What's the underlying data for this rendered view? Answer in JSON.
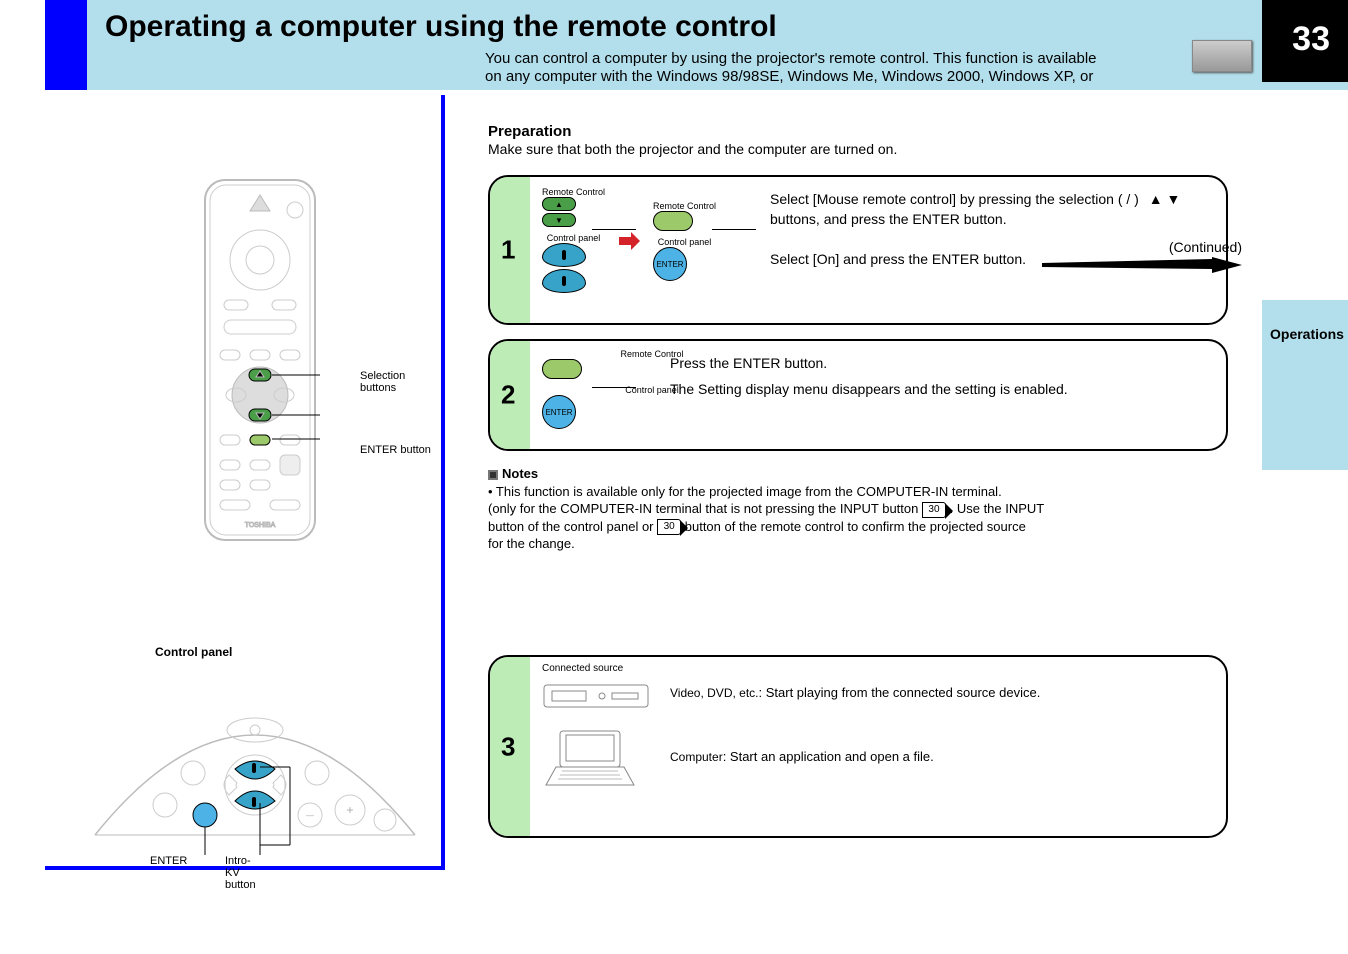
{
  "page_number": "33",
  "header": {
    "title": "Operating a computer using the remote control",
    "subtitle1": "You can control a computer by using the projector's remote control. This function is available",
    "subtitle2": "on any computer with the Windows 98/98SE, Windows Me, Windows 2000, Windows XP, or"
  },
  "side_tab": "Operations",
  "left": {
    "control_panel_label": "Control panel",
    "panel_labels": {
      "enter": "ENTER",
      "intro_kv": "Intro-KV button"
    },
    "callouts": {
      "select": "Selection buttons",
      "enter": "ENTER button"
    }
  },
  "preparation": {
    "heading": "Preparation",
    "text": "Make sure that both the projector and the computer are turned on."
  },
  "step1": {
    "num": "1",
    "remote_label": "Remote Control",
    "panel_label": "Control panel",
    "text_a": "Select [Mouse remote control] by pressing the selection (  /  )",
    "text_b": "buttons, and press the ENTER button.",
    "text_c": "Select [On] and press the ENTER button."
  },
  "step2": {
    "num": "2",
    "remote_label": "Remote Control",
    "panel_label": "Control panel",
    "text_a": "Press the ENTER button.",
    "text_b": "The Setting display menu disappears and the setting is enabled."
  },
  "notes": {
    "heading": "Notes",
    "line1a": "• This function is available only for the projected image from the COMPUTER-IN terminal.",
    "line1b_pre": "(only for the COMPUTER-IN terminal that is not pressing the INPUT button ",
    "line1b_ref": "30",
    "line1b_post": " . Use the INPUT",
    "line2_pre": "button of the control panel or ",
    "line2_ref": "30",
    "line2_post": " button of the remote control to confirm the projected source",
    "line3": "for the change."
  },
  "step3": {
    "num": "3",
    "label_above": "Connected source",
    "line_a_label": "Video, DVD, etc.",
    "line_a_text": "Start playing from the connected source device.",
    "line_b_label": "Computer",
    "line_b_text": "Start an application and open a file."
  },
  "continued": "(Continued)"
}
